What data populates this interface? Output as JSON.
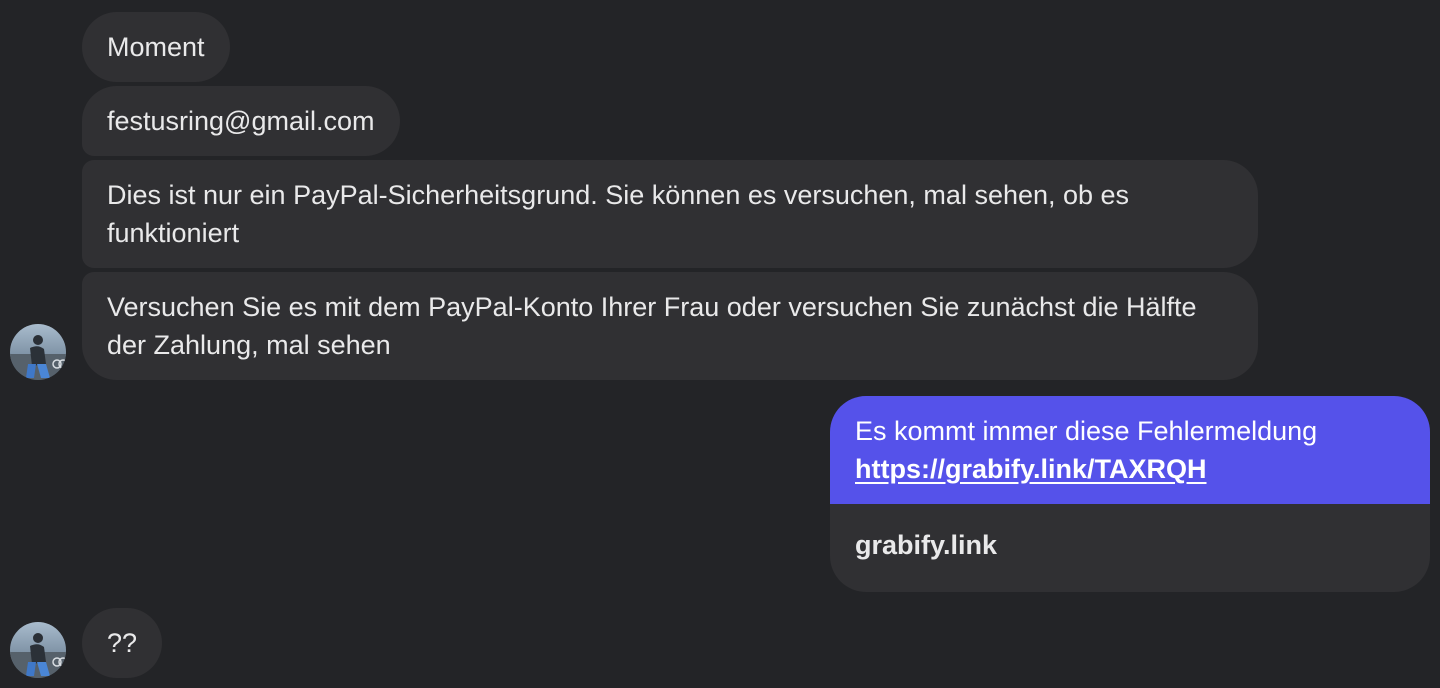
{
  "messages": {
    "received_1": "Moment",
    "received_2": "festusring@gmail.com",
    "received_3": "Dies ist nur ein PayPal-Sicherheitsgrund. Sie können es versuchen, mal sehen, ob es funktioniert",
    "received_4": "Versuchen Sie es mit dem PayPal-Konto Ihrer Frau oder versuchen Sie zunächst die Hälfte der Zahlung, mal sehen",
    "sent_1": {
      "text": "Es kommt immer diese Fehlermeldung",
      "link": "https://grabify.link/TAXRQH",
      "preview_title": "grabify.link"
    },
    "received_5": "??"
  },
  "colors": {
    "background": "#232427",
    "received_bubble": "#303033",
    "sent_bubble": "#5552ea",
    "text": "#e9e9ea"
  }
}
